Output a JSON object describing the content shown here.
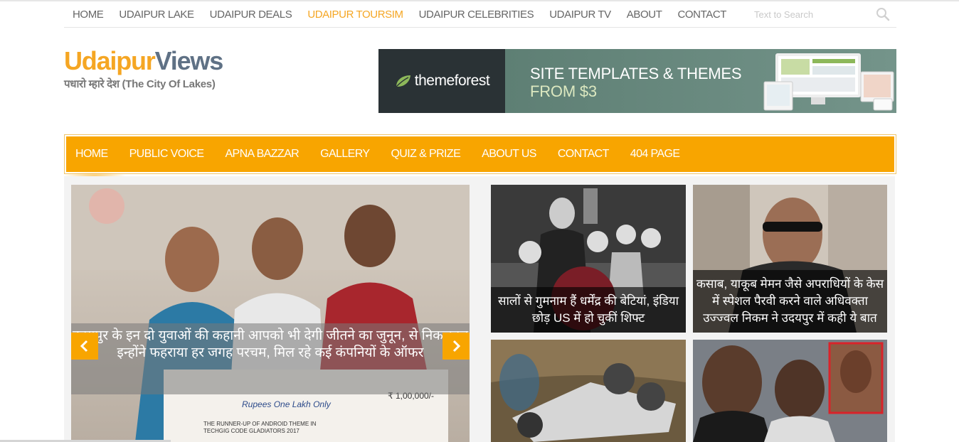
{
  "topnav": {
    "items": [
      "HOME",
      "UDAIPUR LAKE",
      "UDAIPUR DEALS",
      "UDAIPUR TOURSIM",
      "UDAIPUR CELEBRITIES",
      "UDAIPUR TV",
      "ABOUT",
      "CONTACT"
    ],
    "active_index": 3,
    "search_placeholder": "Text to Search"
  },
  "logo": {
    "part1": "Udaipur",
    "part2": "Views",
    "tagline": "पधारो म्हारे देश (The City Of Lakes)"
  },
  "banner": {
    "brand": "themeforest",
    "line1": "SITE TEMPLATES & THEMES",
    "line2": "FROM $3"
  },
  "mainnav": {
    "items": [
      "HOME",
      "PUBLIC VOICE",
      "APNA BAZZAR",
      "GALLERY",
      "QUIZ & PRIZE",
      "ABOUT US",
      "CONTACT",
      "404 PAGE"
    ]
  },
  "slider": {
    "caption": "उदयपुर के इन दो युवाओं की कहानी आपको भी देगी जीतने का जुनून, से निकलकर इन्होंने फहराया हर जगह परचम, मिल रहे कई कंपनियों के ऑफर",
    "check_amount": "₹ 1,00,000/-",
    "check_words": "Rupees One Lakh Only",
    "check_for": "THE RUNNER-UP OF ANDROID THEME IN TECHGIG CODE GLADIATORS 2017",
    "prev_icon": "chevron-left-icon",
    "next_icon": "chevron-right-icon"
  },
  "cards": [
    {
      "caption": "सालों से गुमनाम हैं धर्मेंद्र की बेटियां, इंडिया छोड़ US में हो चुकीं शिफ्ट"
    },
    {
      "caption": "कसाब, याकूब मेमन जैसे अपराधियों के केस में स्पेशल पैरवी करने वाले अधिवक्ता उज्ज्वल निकम ने उदयपुर में कही ये बात"
    },
    {
      "caption": ""
    },
    {
      "caption": ""
    }
  ],
  "colors": {
    "accent": "#f8a500",
    "logo_blue": "#5f7185",
    "nav_text": "#666666"
  }
}
